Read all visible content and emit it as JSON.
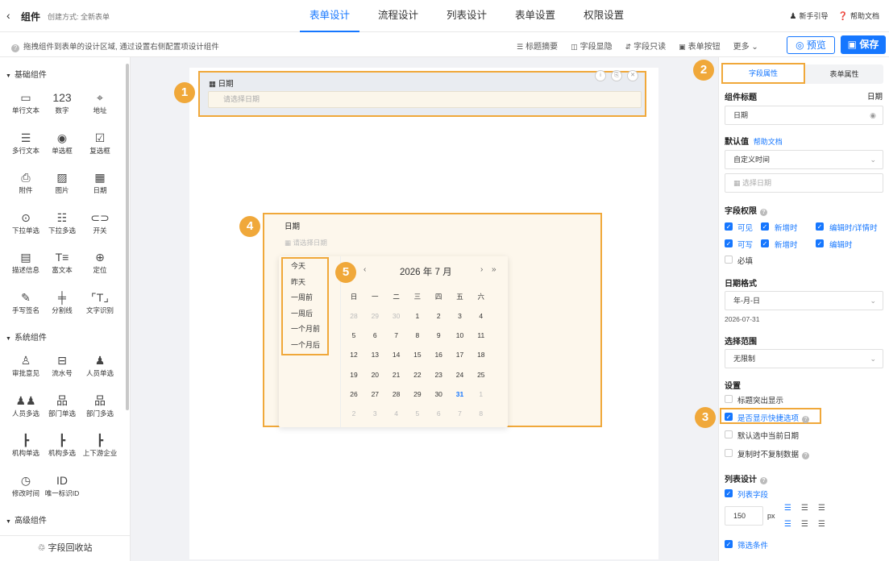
{
  "header": {
    "back_icon": "chevron-left-icon",
    "app_name": "组件",
    "created_by": "创建方式: 全新表单",
    "tabs": [
      {
        "label": "表单设计",
        "active": true
      },
      {
        "label": "流程设计",
        "active": false
      },
      {
        "label": "列表设计",
        "active": false
      },
      {
        "label": "表单设置",
        "active": false
      },
      {
        "label": "权限设置",
        "active": false
      }
    ],
    "guide": "新手引导",
    "help_doc": "帮助文档"
  },
  "toolbar": {
    "hint": "拖拽组件到表单的设计区域, 通过设置右侧配置项设计组件",
    "tools": [
      "标题摘要",
      "字段显隐",
      "字段只读",
      "表单按钮",
      "更多"
    ],
    "preview": "预览",
    "save": "保存"
  },
  "left_panel": {
    "sections": [
      {
        "title": "基础组件",
        "items": [
          {
            "label": "单行文本",
            "icon": "▭"
          },
          {
            "label": "数字",
            "icon": "123"
          },
          {
            "label": "地址",
            "icon": "⌖"
          },
          {
            "label": "多行文本",
            "icon": "☰"
          },
          {
            "label": "单选框",
            "icon": "◉"
          },
          {
            "label": "复选框",
            "icon": "☑"
          },
          {
            "label": "附件",
            "icon": "⎙"
          },
          {
            "label": "图片",
            "icon": "▨"
          },
          {
            "label": "日期",
            "icon": "▦"
          },
          {
            "label": "下拉单选",
            "icon": "⊙"
          },
          {
            "label": "下拉多选",
            "icon": "☷"
          },
          {
            "label": "开关",
            "icon": "⊂⊃"
          },
          {
            "label": "描述信息",
            "icon": "▤"
          },
          {
            "label": "富文本",
            "icon": "T≡"
          },
          {
            "label": "定位",
            "icon": "⊕"
          },
          {
            "label": "手写签名",
            "icon": "✎"
          },
          {
            "label": "分割线",
            "icon": "╪"
          },
          {
            "label": "文字识别",
            "icon": "⌜T⌟"
          }
        ]
      },
      {
        "title": "系统组件",
        "items": [
          {
            "label": "审批意见",
            "icon": "♙"
          },
          {
            "label": "流水号",
            "icon": "⊟"
          },
          {
            "label": "人员单选",
            "icon": "♟"
          },
          {
            "label": "人员多选",
            "icon": "♟♟"
          },
          {
            "label": "部门单选",
            "icon": "品"
          },
          {
            "label": "部门多选",
            "icon": "品"
          },
          {
            "label": "机构单选",
            "icon": "┣"
          },
          {
            "label": "机构多选",
            "icon": "┣"
          },
          {
            "label": "上下游企业",
            "icon": "┣"
          },
          {
            "label": "修改时间",
            "icon": "◷"
          },
          {
            "label": "唯一标识ID",
            "icon": "ID"
          }
        ]
      },
      {
        "title": "高级组件",
        "items": []
      }
    ],
    "recycle_bin": "字段回收站"
  },
  "canvas": {
    "field_label": "日期",
    "field_placeholder": "请选择日期",
    "preview_label": "日期",
    "preview_placeholder": "请选择日期"
  },
  "calendar": {
    "shortcuts": [
      "今天",
      "昨天",
      "一周前",
      "一周后",
      "一个月前",
      "一个月后"
    ],
    "title": "2026 年  7 月",
    "weekdays": [
      "日",
      "一",
      "二",
      "三",
      "四",
      "五",
      "六"
    ],
    "rows": [
      [
        "28",
        "29",
        "30",
        "1",
        "2",
        "3",
        "4"
      ],
      [
        "5",
        "6",
        "7",
        "8",
        "9",
        "10",
        "11"
      ],
      [
        "12",
        "13",
        "14",
        "15",
        "16",
        "17",
        "18"
      ],
      [
        "19",
        "20",
        "21",
        "22",
        "23",
        "24",
        "25"
      ],
      [
        "26",
        "27",
        "28",
        "29",
        "30",
        "31",
        "1"
      ],
      [
        "2",
        "3",
        "4",
        "5",
        "6",
        "7",
        "8"
      ]
    ],
    "today": "31"
  },
  "right_panel": {
    "tab_field": "字段属性",
    "tab_form": "表单属性",
    "component_title_label": "组件标题",
    "component_title_right": "日期",
    "component_title_value": "日期",
    "default_label": "默认值",
    "help_link": "帮助文档",
    "default_type": "自定义时间",
    "default_placeholder": "选择日期",
    "permission_label": "字段权限",
    "perm_row1": [
      "可见",
      "新增时",
      "编辑时/详情时"
    ],
    "perm_row2": [
      "可写",
      "新增时",
      "编辑时"
    ],
    "perm_required": "必填",
    "date_format_label": "日期格式",
    "date_format_value": "年-月-日",
    "date_format_example": "2026-07-31",
    "range_label": "选择范围",
    "range_value": "无限制",
    "settings_label": "设置",
    "settings": [
      {
        "label": "标题突出显示",
        "checked": false
      },
      {
        "label": "是否显示快捷选项",
        "checked": true
      },
      {
        "label": "默认选中当前日期",
        "checked": false
      },
      {
        "label": "复制时不复制数据",
        "checked": false
      }
    ],
    "list_design_label": "列表设计",
    "list_field": "列表字段",
    "width_value": "150",
    "width_unit": "px",
    "filter": "筛选条件"
  },
  "badges": [
    "1",
    "2",
    "3",
    "4",
    "5"
  ],
  "colors": {
    "accent": "#1677ff",
    "highlight": "#f0a83a"
  }
}
